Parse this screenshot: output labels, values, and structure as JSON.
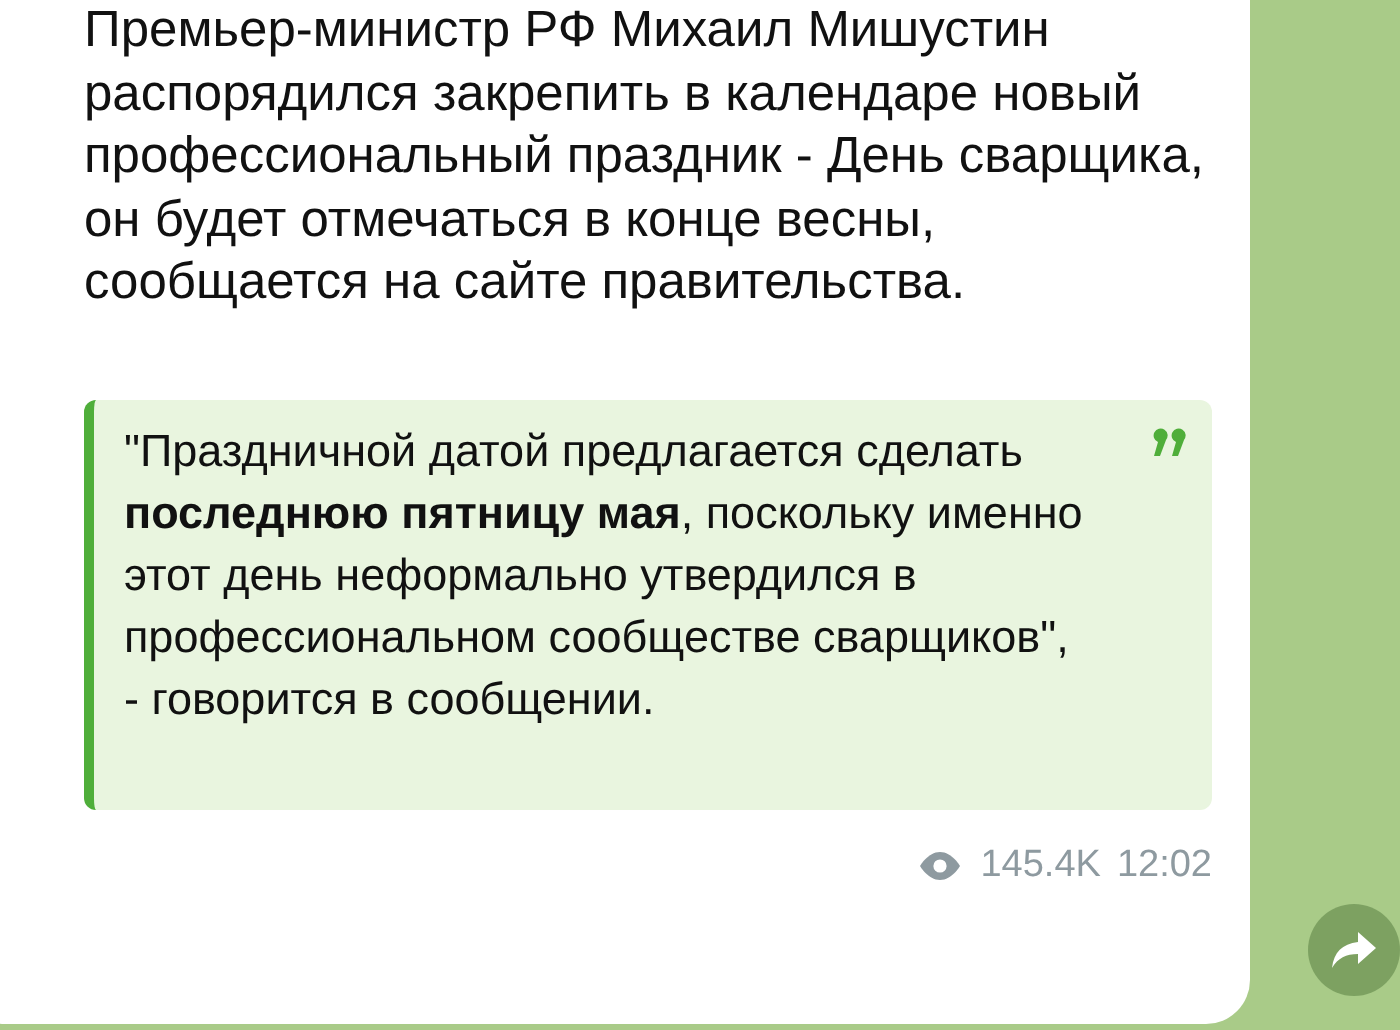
{
  "message": {
    "text": "Премьер-министр РФ Михаил Мишустин распорядился закрепить в календаре новый профессиональный праздник - День сварщика, он будет отмечаться в конце весны, сообщается на сайте правительства.",
    "quote": "\"Праздничной датой предлагается сделать **последнюю пятницу мая**, поскольку именно этот день неформально утвердился в профессиональном сообществе сварщиков\", - говорится в сообщении.",
    "views": "145.4K",
    "time": "12:02"
  }
}
